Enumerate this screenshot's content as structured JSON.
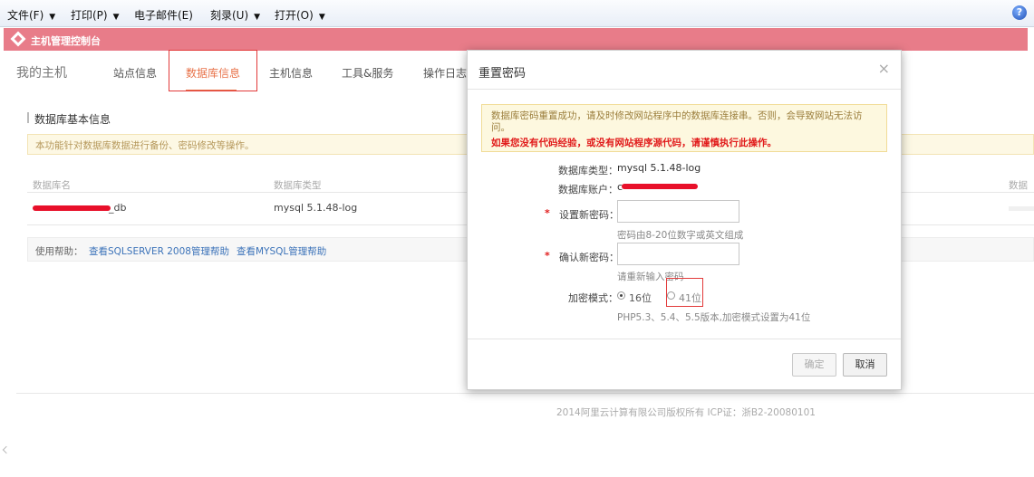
{
  "menubar": {
    "items": [
      {
        "label": "文件(F)",
        "caret": "▼"
      },
      {
        "label": "打印(P)",
        "caret": "▼"
      },
      {
        "label": "电子邮件(E)",
        "caret": ""
      },
      {
        "label": "刻录(U)",
        "caret": "▼"
      },
      {
        "label": "打开(O)",
        "caret": "▼"
      }
    ],
    "help_glyph": "?"
  },
  "console": {
    "title": "主机管理控制台",
    "bar_color": "#e87c89"
  },
  "nav": {
    "brand": "我的主机",
    "tabs": [
      "站点信息",
      "数据库信息",
      "主机信息",
      "工具&服务",
      "操作日志"
    ],
    "active_tab": "数据库信息",
    "accent_color": "#e8734a"
  },
  "db_section": {
    "title": "数据库基本信息",
    "notice": "本功能针对数据库数据进行备份、密码修改等操作。",
    "columns": [
      "数据库名",
      "数据库类型",
      "数据"
    ],
    "row": {
      "name_suffix": "_db",
      "type": "mysql 5.1.48-log"
    },
    "help": {
      "label": "使用帮助：",
      "links": [
        "查看SQLSERVER 2008管理帮助",
        "查看MYSQL管理帮助"
      ]
    }
  },
  "footer": "2014阿里云计算有限公司版权所有 ICP证：浙B2-20080101",
  "modal": {
    "title": "重置密码",
    "close_glyph": "×",
    "warning_line1": "数据库密码重置成功，请及时修改网站程序中的数据库连接串。否则，会导致网站无法访问。",
    "warning_line2": "如果您没有代码经验，或没有网站程序源代码，请谨慎执行此操作。",
    "db_type_label": "数据库类型：",
    "db_type_value": "mysql 5.1.48-log",
    "db_account_label": "数据库账户：",
    "db_account_prefix": "c",
    "new_password_label": "设置新密码：",
    "new_password_value": "",
    "new_password_hint": "密码由8-20位数字或英文组成",
    "confirm_password_label": "确认新密码：",
    "confirm_password_value": "",
    "confirm_password_hint": "请重新输入密码",
    "required_mark": "*",
    "encrypt_label": "加密模式：",
    "encrypt_options": [
      {
        "label": "16位",
        "selected": true
      },
      {
        "label": "41位",
        "selected": false
      }
    ],
    "encrypt_hint": "PHP5.3、5.4、5.5版本,加密模式设置为41位",
    "ok_button": "确定",
    "cancel_button": "取消",
    "redaction_color": "#e8102a"
  }
}
